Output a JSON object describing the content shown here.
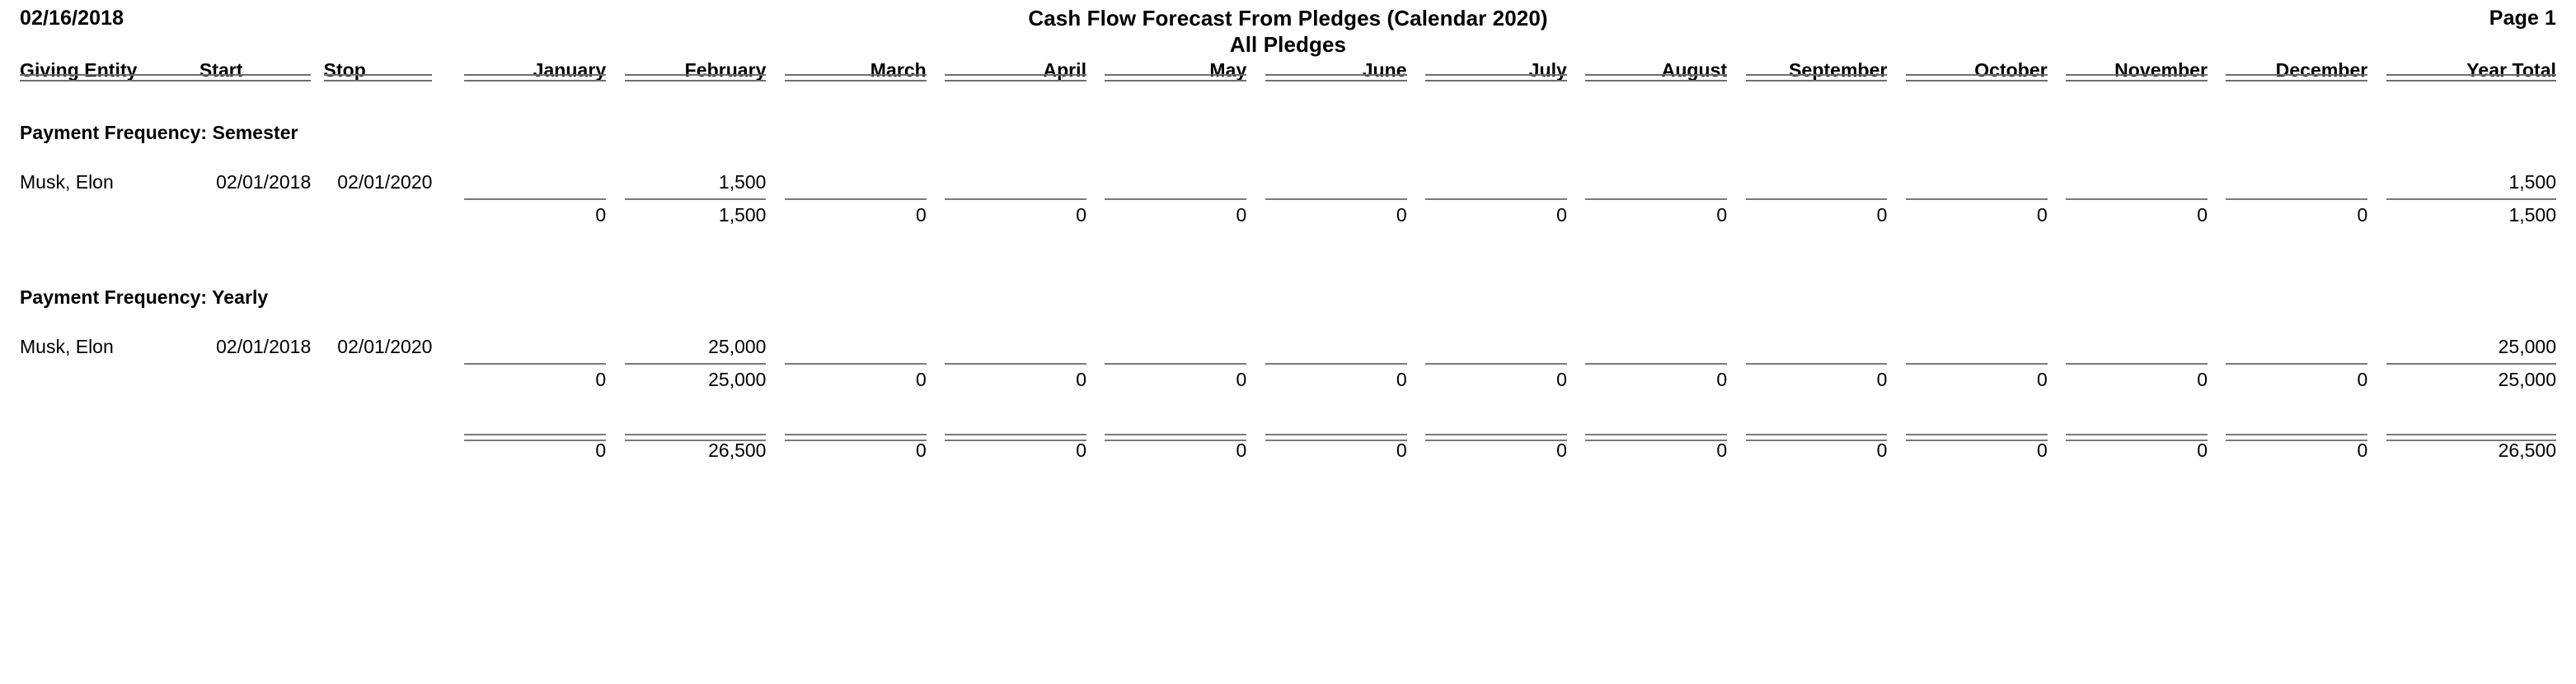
{
  "header": {
    "date": "02/16/2018",
    "title": "Cash Flow Forecast From Pledges (Calendar 2020)",
    "subtitle": "All Pledges",
    "page": "Page 1"
  },
  "columns": {
    "entity": "Giving Entity",
    "start": "Start",
    "stop": "Stop",
    "months": [
      "January",
      "February",
      "March",
      "April",
      "May",
      "June",
      "July",
      "August",
      "September",
      "October",
      "November",
      "December"
    ],
    "year_total": "Year Total"
  },
  "groups": [
    {
      "title": "Payment Frequency: Semester",
      "rows": [
        {
          "entity": "Musk, Elon",
          "start": "02/01/2018",
          "stop": "02/01/2020",
          "months": [
            "",
            "1,500",
            "",
            "",
            "",
            "",
            "",
            "",
            "",
            "",
            "",
            ""
          ],
          "year_total": "1,500"
        }
      ],
      "subtotal": {
        "months": [
          "0",
          "1,500",
          "0",
          "0",
          "0",
          "0",
          "0",
          "0",
          "0",
          "0",
          "0",
          "0"
        ],
        "year_total": "1,500"
      }
    },
    {
      "title": "Payment Frequency: Yearly",
      "rows": [
        {
          "entity": "Musk, Elon",
          "start": "02/01/2018",
          "stop": "02/01/2020",
          "months": [
            "",
            "25,000",
            "",
            "",
            "",
            "",
            "",
            "",
            "",
            "",
            "",
            ""
          ],
          "year_total": "25,000"
        }
      ],
      "subtotal": {
        "months": [
          "0",
          "25,000",
          "0",
          "0",
          "0",
          "0",
          "0",
          "0",
          "0",
          "0",
          "0",
          "0"
        ],
        "year_total": "25,000"
      }
    }
  ],
  "grand_total": {
    "months": [
      "0",
      "26,500",
      "0",
      "0",
      "0",
      "0",
      "0",
      "0",
      "0",
      "0",
      "0",
      "0"
    ],
    "year_total": "26,500"
  },
  "colors": {
    "text": "#000000",
    "rule": "#6e6e6e",
    "background": "#ffffff"
  }
}
